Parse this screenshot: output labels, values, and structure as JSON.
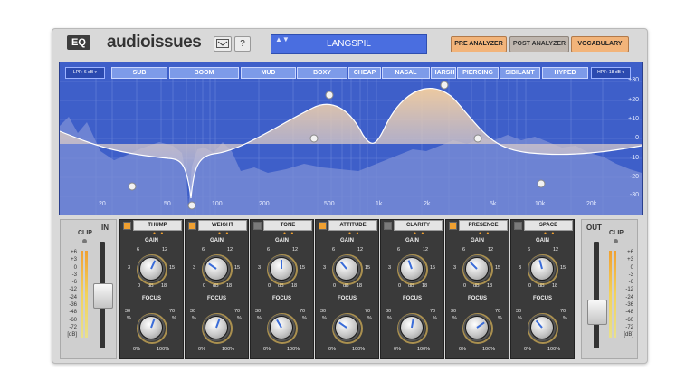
{
  "header": {
    "logo": "EQ",
    "brand": "audioissues",
    "help_label": "?",
    "preset_name": "LANGSPIL",
    "preset_arrows": "▲▼",
    "pre_analyzer": "PRE ANALYZER",
    "post_analyzer": "POST ANALYZER",
    "vocabulary": "VOCABULARY"
  },
  "display": {
    "lpf_label": "LPF: 6 dB ▾",
    "hpf_label": "HPF: 18 dB ▾",
    "bands": [
      "SUB",
      "BOOM",
      "MUD",
      "BOXY",
      "CHEAP",
      "NASAL",
      "HARSH",
      "PIERCING",
      "SIBILANT",
      "HYPED"
    ],
    "freq_ticks": [
      "20",
      "50",
      "100",
      "200",
      "500",
      "1k",
      "2k",
      "5k",
      "10k",
      "20k"
    ],
    "db_ticks": [
      "+30",
      "+20",
      "+10",
      "0",
      "-10",
      "-20",
      "-30"
    ]
  },
  "input": {
    "clip": "CLIP",
    "title": "IN",
    "scale": [
      "+6",
      "+3",
      "0",
      "-3",
      "-6",
      "-12",
      "-24",
      "-36",
      "-48",
      "-60",
      "-72",
      "[dB]"
    ]
  },
  "output": {
    "clip": "CLIP",
    "title": "OUT",
    "scale": [
      "+6",
      "+3",
      "0",
      "-3",
      "-6",
      "-12",
      "-24",
      "-36",
      "-48",
      "-60",
      "-72",
      "[dB]"
    ]
  },
  "modules": [
    {
      "name": "THUMP",
      "gain_label": "GAIN",
      "focus_label": "FOCUS",
      "gain_ticks": [
        "6",
        "12",
        "3",
        "15",
        "0",
        "dB",
        "18"
      ],
      "focus_ticks": [
        "30",
        "70",
        "%",
        "%",
        "0%",
        "100%"
      ]
    },
    {
      "name": "WEIGHT",
      "gain_label": "GAIN",
      "focus_label": "FOCUS",
      "gain_ticks": [
        "6",
        "12",
        "3",
        "15",
        "0",
        "dB",
        "18"
      ],
      "focus_ticks": [
        "30",
        "70",
        "%",
        "%",
        "0%",
        "100%"
      ]
    },
    {
      "name": "TONE",
      "gain_label": "GAIN",
      "focus_label": "FOCUS",
      "gain_ticks": [
        "6",
        "12",
        "3",
        "15",
        "0",
        "dB",
        "18"
      ],
      "focus_ticks": [
        "30",
        "70",
        "%",
        "%",
        "0%",
        "100%"
      ]
    },
    {
      "name": "ATTITUDE",
      "gain_label": "GAIN",
      "focus_label": "FOCUS",
      "gain_ticks": [
        "6",
        "12",
        "3",
        "15",
        "0",
        "dB",
        "18"
      ],
      "focus_ticks": [
        "30",
        "70",
        "%",
        "%",
        "0%",
        "100%"
      ]
    },
    {
      "name": "CLARITY",
      "gain_label": "GAIN",
      "focus_label": "FOCUS",
      "gain_ticks": [
        "6",
        "12",
        "3",
        "15",
        "0",
        "dB",
        "18"
      ],
      "focus_ticks": [
        "30",
        "70",
        "%",
        "%",
        "0%",
        "100%"
      ]
    },
    {
      "name": "PRESENCE",
      "gain_label": "GAIN",
      "focus_label": "FOCUS",
      "gain_ticks": [
        "6",
        "12",
        "3",
        "15",
        "0",
        "dB",
        "18"
      ],
      "focus_ticks": [
        "30",
        "70",
        "%",
        "%",
        "0%",
        "100%"
      ]
    },
    {
      "name": "SPACE",
      "gain_label": "GAIN",
      "focus_label": "FOCUS",
      "gain_ticks": [
        "6",
        "12",
        "3",
        "15",
        "0",
        "dB",
        "18"
      ],
      "focus_ticks": [
        "30",
        "70",
        "%",
        "%",
        "0%",
        "100%"
      ]
    }
  ],
  "colors": {
    "accent": "#f0a030",
    "display_bg": "#3e5fc9",
    "preset_bg": "#4a6ee0",
    "knob_pointer": "#3a6cd8"
  }
}
